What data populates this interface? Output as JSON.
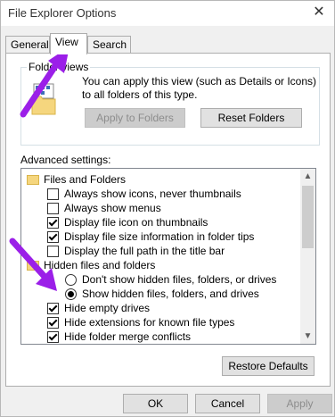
{
  "window": {
    "title": "File Explorer Options",
    "close": "✕"
  },
  "tabs": [
    {
      "label": "General"
    },
    {
      "label": "View"
    },
    {
      "label": "Search"
    }
  ],
  "folder_views": {
    "legend": "Folder views",
    "description": "You can apply this view (such as Details or Icons) to all folders of this type.",
    "apply_label": "Apply to Folders",
    "reset_label": "Reset Folders"
  },
  "advanced": {
    "label": "Advanced settings:",
    "items": [
      {
        "kind": "folder",
        "label": "Files and Folders"
      },
      {
        "kind": "checkbox",
        "checked": false,
        "label": "Always show icons, never thumbnails"
      },
      {
        "kind": "checkbox",
        "checked": false,
        "label": "Always show menus"
      },
      {
        "kind": "checkbox",
        "checked": true,
        "label": "Display file icon on thumbnails"
      },
      {
        "kind": "checkbox",
        "checked": true,
        "label": "Display file size information in folder tips"
      },
      {
        "kind": "checkbox",
        "checked": false,
        "label": "Display the full path in the title bar"
      },
      {
        "kind": "folder",
        "label": "Hidden files and folders"
      },
      {
        "kind": "radio",
        "checked": false,
        "label": "Don't show hidden files, folders, or drives"
      },
      {
        "kind": "radio",
        "checked": true,
        "label": "Show hidden files, folders, and drives"
      },
      {
        "kind": "checkbox",
        "checked": true,
        "label": "Hide empty drives"
      },
      {
        "kind": "checkbox",
        "checked": true,
        "label": "Hide extensions for known file types"
      },
      {
        "kind": "checkbox",
        "checked": true,
        "label": "Hide folder merge conflicts"
      }
    ]
  },
  "restore_label": "Restore Defaults",
  "footer": {
    "ok": "OK",
    "cancel": "Cancel",
    "apply": "Apply"
  },
  "colors": {
    "annotation_arrow": "#9b1fe8",
    "accent": "#0078d7"
  }
}
